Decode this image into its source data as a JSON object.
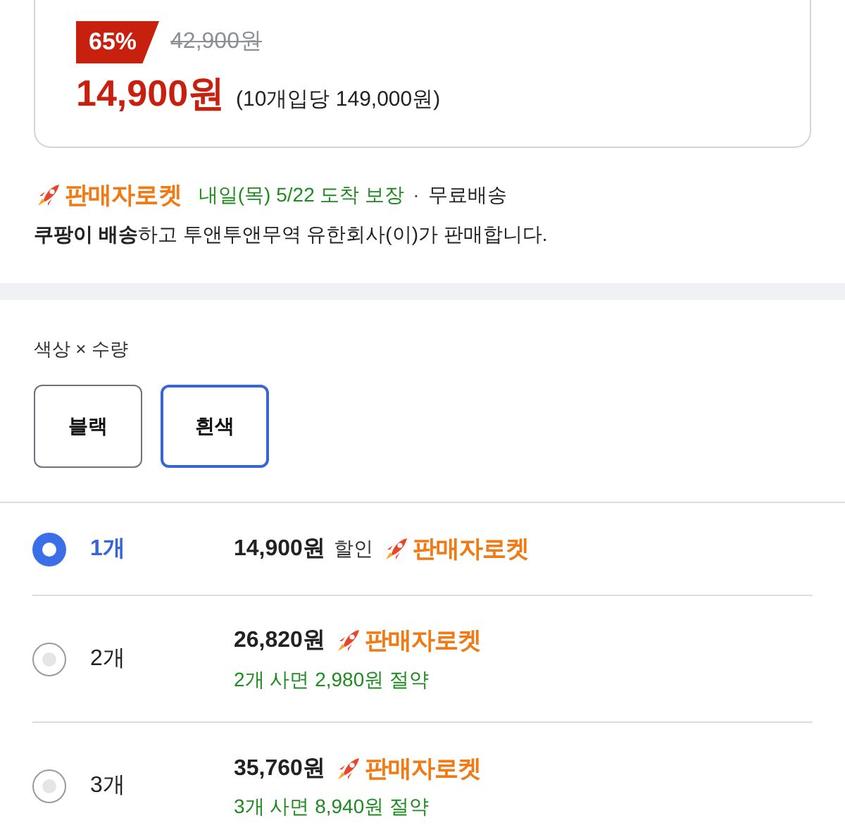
{
  "price_card": {
    "discount": "65%",
    "original_price": "42,900원",
    "price": "14,900원",
    "unit_price": "(10개입당 149,000원)"
  },
  "delivery": {
    "badge": "판매자로켓",
    "arrival": "내일(목) 5/22 도착 보장",
    "separator": "·",
    "shipping": "무료배송",
    "seller_note": "**쿠팡이 배송**하고 투앤투앤무역 유한회사(이)가 판매합니다."
  },
  "options": {
    "label": "색상 × 수량",
    "colors": [
      {
        "label": "블랙",
        "selected": false
      },
      {
        "label": "흰색",
        "selected": true
      }
    ]
  },
  "quantities": [
    {
      "quantity": "1개",
      "price": "14,900원",
      "discount_label": "할인",
      "badge": "판매자로켓",
      "selected": true
    },
    {
      "quantity": "2개",
      "price": "26,820원",
      "badge": "판매자로켓",
      "savings": "2개 사면 2,980원 절약",
      "selected": false
    },
    {
      "quantity": "3개",
      "price": "35,760원",
      "badge": "판매자로켓",
      "savings": "3개 사면 8,940원 절약",
      "selected": false
    }
  ]
}
